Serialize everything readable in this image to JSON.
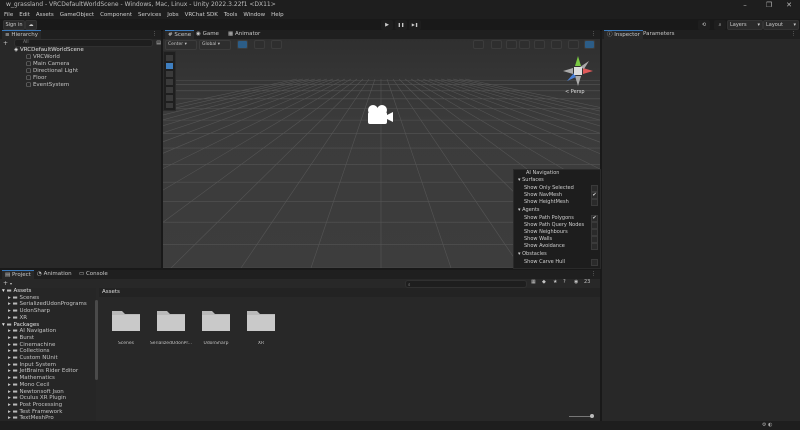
{
  "window": {
    "title": "w_grassland - VRCDefaultWorldScene - Windows, Mac, Linux - Unity 2022.3.22f1 <DX11>",
    "controls": [
      "–",
      "❐",
      "✕"
    ]
  },
  "menu": [
    "File",
    "Edit",
    "Assets",
    "GameObject",
    "Component",
    "Services",
    "Jobs",
    "VRChat SDK",
    "Tools",
    "Window",
    "Help"
  ],
  "toolbar": {
    "sign_in": "Sign in",
    "play": "▶",
    "pause": "❚❚",
    "step": "▶❚",
    "layers": "Layers",
    "layout": "Layout"
  },
  "hierarchy": {
    "tab": "Hierarchy",
    "add": "+",
    "search_placeholder": "All",
    "scene": "VRCDefaultWorldScene",
    "items": [
      "VRCWorld",
      "Main Camera",
      "Directional Light",
      "Floor",
      "EventSystem"
    ]
  },
  "scene_view": {
    "tabs": [
      "Scene",
      "Game",
      "Animator"
    ],
    "pivot": "Center",
    "space": "Global",
    "persp": "< Persp",
    "axes": {
      "y": "y",
      "x": "x",
      "z": "z"
    }
  },
  "inspector": {
    "tabs": [
      "Inspector",
      "Parameters"
    ]
  },
  "ai_navigation": {
    "title": "AI Navigation",
    "sections": [
      {
        "name": "Surfaces",
        "items": [
          {
            "label": "Show Only Selected",
            "checked": false
          },
          {
            "label": "Show NavMesh",
            "checked": true
          },
          {
            "label": "Show HeightMesh",
            "checked": false
          }
        ]
      },
      {
        "name": "Agents",
        "items": [
          {
            "label": "Show Path Polygons",
            "checked": true
          },
          {
            "label": "Show Path Query Nodes",
            "checked": false
          },
          {
            "label": "Show Neighbours",
            "checked": false
          },
          {
            "label": "Show Walls",
            "checked": false
          },
          {
            "label": "Show Avoidance",
            "checked": false
          }
        ]
      },
      {
        "name": "Obstacles",
        "items": [
          {
            "label": "Show Carve Hull",
            "checked": false
          }
        ]
      }
    ]
  },
  "project": {
    "tabs": [
      "Project",
      "Animation",
      "Console"
    ],
    "add": "+",
    "hidden_count": "23",
    "tree": {
      "assets_root": "Assets",
      "assets": [
        "Scenes",
        "SerializedUdonPrograms",
        "UdonSharp",
        "XR"
      ],
      "packages_root": "Packages",
      "packages": [
        "AI Navigation",
        "Burst",
        "Cinemachine",
        "Collections",
        "Custom NUnit",
        "Input System",
        "JetBrains Rider Editor",
        "Mathematics",
        "Mono Cecil",
        "Newtonsoft Json",
        "Oculus XR Plugin",
        "Post Processing",
        "Test Framework",
        "TextMeshPro"
      ]
    },
    "breadcrumb": "Assets",
    "folders": [
      "Scenes",
      "SerializedUdonPr...",
      "UdonSharp",
      "XR"
    ]
  }
}
